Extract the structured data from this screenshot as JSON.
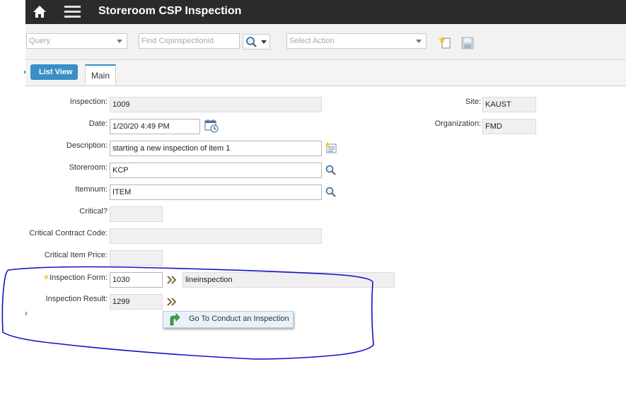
{
  "header": {
    "title": "Storeroom CSP Inspection"
  },
  "toolbar": {
    "query_placeholder": "Query",
    "find_placeholder": "Find Cspinspectionid",
    "action_placeholder": "Select Action"
  },
  "tabs": {
    "list_view": "List View",
    "main": "Main"
  },
  "form": {
    "inspection": {
      "label": "Inspection:",
      "value": "1009"
    },
    "date": {
      "label": "Date:",
      "value": "1/20/20 4:49 PM"
    },
    "description": {
      "label": "Description:",
      "value": "starting a new inspection of item 1"
    },
    "storeroom": {
      "label": "Storeroom:",
      "value": "KCP"
    },
    "itemnum": {
      "label": "Itemnum:",
      "value": "ITEM"
    },
    "critical": {
      "label": "Critical?",
      "value": ""
    },
    "critical_contract_code": {
      "label": "Critical Contract Code:",
      "value": ""
    },
    "critical_item_price": {
      "label": "Critical Item Price:",
      "value": ""
    },
    "inspection_form": {
      "label": "Inspection Form:",
      "value": "1030",
      "description": "lineinspection",
      "required_marker": "✳"
    },
    "inspection_result": {
      "label": "Inspection Result:",
      "value": "1299"
    },
    "site": {
      "label": "Site:",
      "value": "KAUST"
    },
    "organization": {
      "label": "Organization:",
      "value": "FMD"
    }
  },
  "goto": {
    "label": "Go To Conduct an Inspection"
  },
  "colors": {
    "accent": "#3a8fc7",
    "annotation": "#1010c8",
    "topbar": "#2b2b2b"
  }
}
